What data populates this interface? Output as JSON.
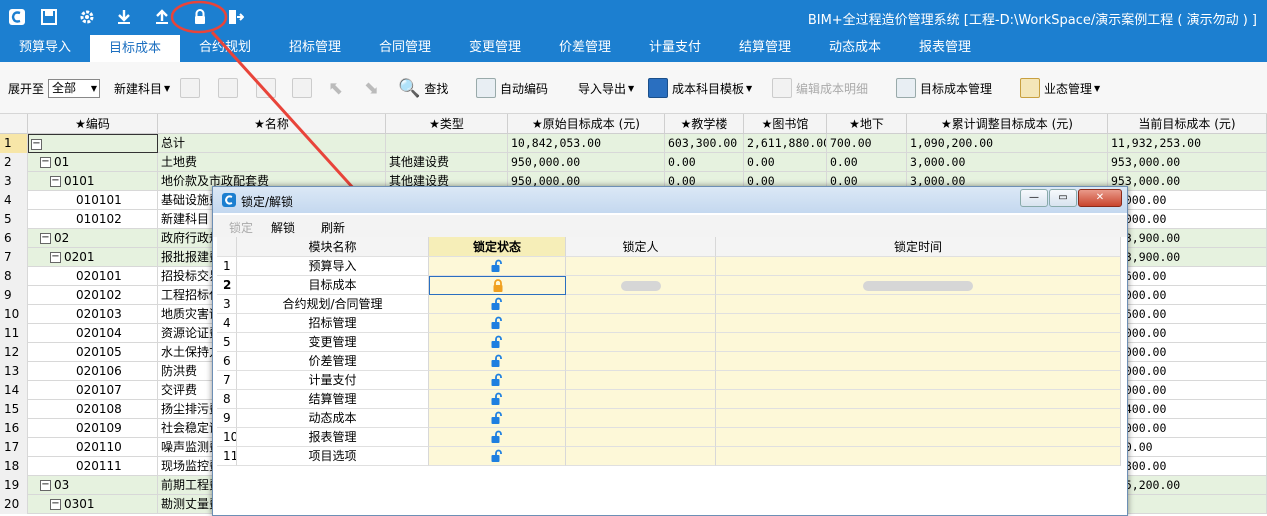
{
  "window": {
    "title": "BIM+全过程造价管理系统 [工程-D:\\WorkSpace/演示案例工程 ( 演示勿动 ) ]"
  },
  "colors": {
    "brand": "#1c7fd0",
    "green_row": "#e6f2df",
    "lock_locked": "#f0a020",
    "lock_open": "#1e7fe0",
    "annotation": "#e8443a"
  },
  "quick_icons": [
    "app-logo-icon",
    "save-icon",
    "settings-gear-icon",
    "download-icon",
    "upload-icon",
    "lock-icon",
    "exit-icon"
  ],
  "tabs": [
    "预算导入",
    "目标成本",
    "合约规划",
    "招标管理",
    "合同管理",
    "变更管理",
    "价差管理",
    "计量支付",
    "结算管理",
    "动态成本",
    "报表管理"
  ],
  "active_tab": "目标成本",
  "toolbar": {
    "expand_label": "展开至",
    "expand_value": "全部",
    "new_subject": "新建科目",
    "search": "查找",
    "auto_code": "自动编码",
    "import_export": "导入导出",
    "template": "成本科目模板",
    "edit_detail": "编辑成本明细",
    "target_mgmt": "目标成本管理",
    "state_mgmt": "业态管理"
  },
  "grid": {
    "headers": [
      "★编码",
      "★名称",
      "★类型",
      "★原始目标成本 (元)",
      "★教学楼",
      "★图书馆",
      "★地下",
      "★累计调整目标成本 (元)",
      "当前目标成本 (元)"
    ],
    "rows": [
      {
        "n": "1",
        "code": "",
        "name": "总计",
        "type": "",
        "orig": "10,842,053.00",
        "a": "603,300.00",
        "b": "2,611,880.00",
        "c": "700.00",
        "adj": "1,090,200.00",
        "cur": "11,932,253.00",
        "level": 0,
        "green": true
      },
      {
        "n": "2",
        "code": "01",
        "name": "土地费",
        "type": "其他建设费",
        "orig": "950,000.00",
        "a": "0.00",
        "b": "0.00",
        "c": "0.00",
        "adj": "3,000.00",
        "cur": "953,000.00",
        "level": 1,
        "green": true
      },
      {
        "n": "3",
        "code": "0101",
        "name": "地价款及市政配套费",
        "type": "其他建设费",
        "orig": "950,000.00",
        "a": "0.00",
        "b": "0.00",
        "c": "0.00",
        "adj": "3,000.00",
        "cur": "953,000.00",
        "level": 2,
        "green": true
      },
      {
        "n": "4",
        "code": "010101",
        "name": "基础设施费",
        "type": "",
        "orig": "",
        "a": "",
        "b": "",
        "c": "",
        "adj": "",
        "cur": "3,000.00",
        "level": 3,
        "green": false
      },
      {
        "n": "5",
        "code": "010102",
        "name": "新建科目",
        "type": "",
        "orig": "",
        "a": "",
        "b": "",
        "c": "",
        "adj": "",
        "cur": "3,000.00",
        "level": 3,
        "green": false
      },
      {
        "n": "6",
        "code": "02",
        "name": "政府行政规费",
        "type": "",
        "orig": "",
        "a": "",
        "b": "",
        "c": "",
        "adj": "",
        "cur": "183,900.00",
        "level": 1,
        "green": true
      },
      {
        "n": "7",
        "code": "0201",
        "name": "报批报建费",
        "type": "",
        "orig": "",
        "a": "",
        "b": "",
        "c": "",
        "adj": "",
        "cur": "183,900.00",
        "level": 2,
        "green": true
      },
      {
        "n": "8",
        "code": "020101",
        "name": "招投标交易费",
        "type": "",
        "orig": "",
        "a": "",
        "b": "",
        "c": "",
        "adj": "",
        "cur": "4,600.00",
        "level": 3,
        "green": false
      },
      {
        "n": "9",
        "code": "020102",
        "name": "工程招标代理费",
        "type": "",
        "orig": "",
        "a": "",
        "b": "",
        "c": "",
        "adj": "",
        "cur": "5,000.00",
        "level": 3,
        "green": false
      },
      {
        "n": "10",
        "code": "020103",
        "name": "地质灾害评估费",
        "type": "",
        "orig": "",
        "a": "",
        "b": "",
        "c": "",
        "adj": "",
        "cur": "1,600.00",
        "level": 3,
        "green": false
      },
      {
        "n": "11",
        "code": "020104",
        "name": "资源论证费",
        "type": "",
        "orig": "",
        "a": "",
        "b": "",
        "c": "",
        "adj": "",
        "cur": "4,000.00",
        "level": 3,
        "green": false
      },
      {
        "n": "12",
        "code": "020105",
        "name": "水土保持方案费",
        "type": "",
        "orig": "",
        "a": "",
        "b": "",
        "c": "",
        "adj": "",
        "cur": "3,000.00",
        "level": 3,
        "green": false
      },
      {
        "n": "13",
        "code": "020106",
        "name": "防洪费",
        "type": "",
        "orig": "",
        "a": "",
        "b": "",
        "c": "",
        "adj": "",
        "cur": "1,000.00",
        "level": 3,
        "green": false
      },
      {
        "n": "14",
        "code": "020107",
        "name": "交评费",
        "type": "",
        "orig": "",
        "a": "",
        "b": "",
        "c": "",
        "adj": "",
        "cur": "1,000.00",
        "level": 3,
        "green": false
      },
      {
        "n": "15",
        "code": "020108",
        "name": "扬尘排污费",
        "type": "",
        "orig": "",
        "a": "",
        "b": "",
        "c": "",
        "adj": "",
        "cur": "2,400.00",
        "level": 3,
        "green": false
      },
      {
        "n": "16",
        "code": "020109",
        "name": "社会稳定评估费",
        "type": "",
        "orig": "",
        "a": "",
        "b": "",
        "c": "",
        "adj": "",
        "cur": "1,000.00",
        "level": 3,
        "green": false
      },
      {
        "n": "17",
        "code": "020110",
        "name": "噪声监测费",
        "type": "",
        "orig": "",
        "a": "",
        "b": "",
        "c": "",
        "adj": "",
        "cur": "500.00",
        "level": 3,
        "green": false
      },
      {
        "n": "18",
        "code": "020111",
        "name": "现场监控费",
        "type": "",
        "orig": "",
        "a": "",
        "b": "",
        "c": "",
        "adj": "",
        "cur": "1,800.00",
        "level": 3,
        "green": false
      },
      {
        "n": "19",
        "code": "03",
        "name": "前期工程费",
        "type": "",
        "orig": "",
        "a": "",
        "b": "",
        "c": "",
        "adj": "",
        "cur": "105,200.00",
        "level": 1,
        "green": true
      },
      {
        "n": "20",
        "code": "0301",
        "name": "勘测丈量费",
        "type": "",
        "orig": "",
        "a": "",
        "b": "",
        "c": "",
        "adj": "",
        "cur": "",
        "level": 2,
        "green": true
      }
    ]
  },
  "dialog": {
    "title": "锁定/解锁",
    "window_buttons": [
      "—",
      "▭",
      "✕"
    ],
    "toolbar": {
      "lock": "锁定",
      "unlock": "解锁",
      "refresh": "刷新"
    },
    "headers": [
      "模块名称",
      "锁定状态",
      "锁定人",
      "锁定时间"
    ],
    "rows": [
      {
        "n": "1",
        "name": "预算导入",
        "locked": false
      },
      {
        "n": "2",
        "name": "目标成本",
        "locked": true
      },
      {
        "n": "3",
        "name": "合约规划/合同管理",
        "locked": false
      },
      {
        "n": "4",
        "name": "招标管理",
        "locked": false
      },
      {
        "n": "5",
        "name": "变更管理",
        "locked": false
      },
      {
        "n": "6",
        "name": "价差管理",
        "locked": false
      },
      {
        "n": "7",
        "name": "计量支付",
        "locked": false
      },
      {
        "n": "8",
        "name": "结算管理",
        "locked": false
      },
      {
        "n": "9",
        "name": "动态成本",
        "locked": false
      },
      {
        "n": "10",
        "name": "报表管理",
        "locked": false
      },
      {
        "n": "11",
        "name": "项目选项",
        "locked": false
      }
    ]
  }
}
